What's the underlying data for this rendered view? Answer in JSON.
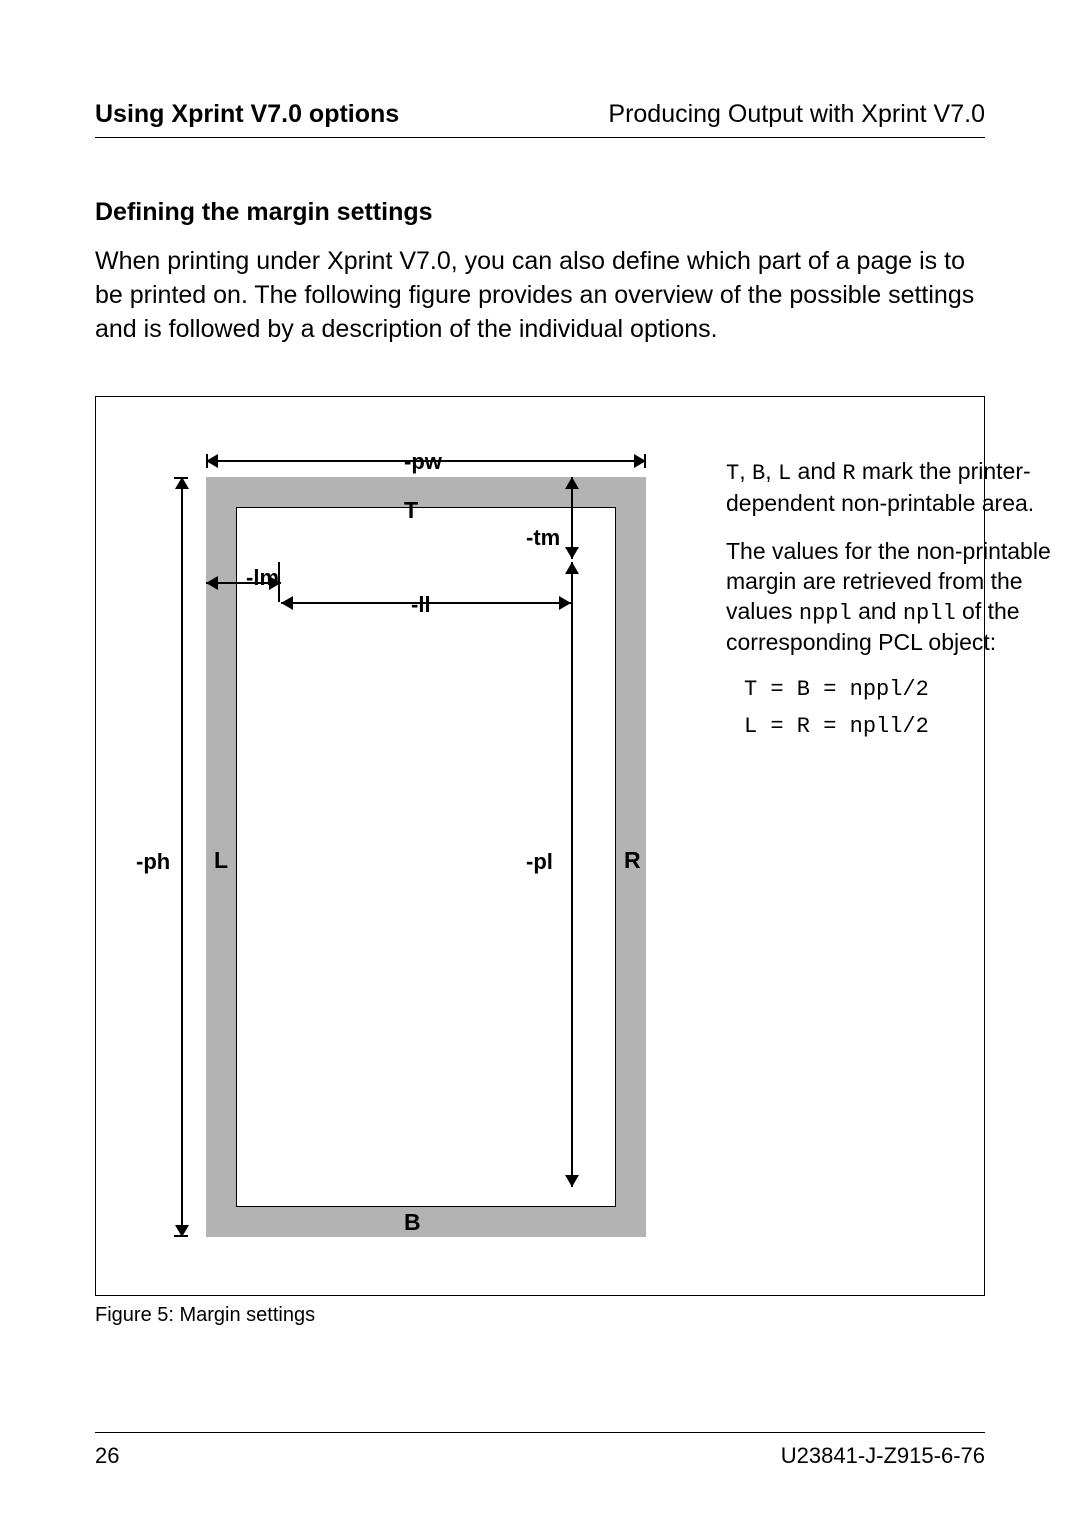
{
  "header": {
    "left": "Using Xprint V7.0 options",
    "right": "Producing Output with Xprint V7.0"
  },
  "section_title": "Defining the margin settings",
  "body_para": "When printing under Xprint V7.0, you can also define which part of a page is to be printed on. The following figure provides an overview of the possible settings and is followed by a description of the individual options.",
  "diagram": {
    "labels": {
      "T": "T",
      "B": "B",
      "L": "L",
      "R": "R"
    },
    "options": {
      "pw": "-pw",
      "ph": "-ph",
      "tm": "-tm",
      "lm": "-lm",
      "ll": "-ll",
      "pl": "-pl"
    }
  },
  "side": {
    "p1_prefix_codes": [
      "T",
      "B",
      "L",
      "R"
    ],
    "p1_joins": [
      ", ",
      ", ",
      " and "
    ],
    "p1_rest": " mark the printer-dependent non-printable area.",
    "p2a": "The values for the non-printable margin are retrieved from the values ",
    "p2_code1": "nppl",
    "p2_mid": " and ",
    "p2_code2": "npll",
    "p2b": " of the corresponding PCL object:",
    "eq1": "T = B = nppl/2",
    "eq2": "L = R = npll/2"
  },
  "caption": "Figure 5: Margin settings",
  "footer": {
    "page": "26",
    "docid": "U23841-J-Z915-6-76"
  }
}
